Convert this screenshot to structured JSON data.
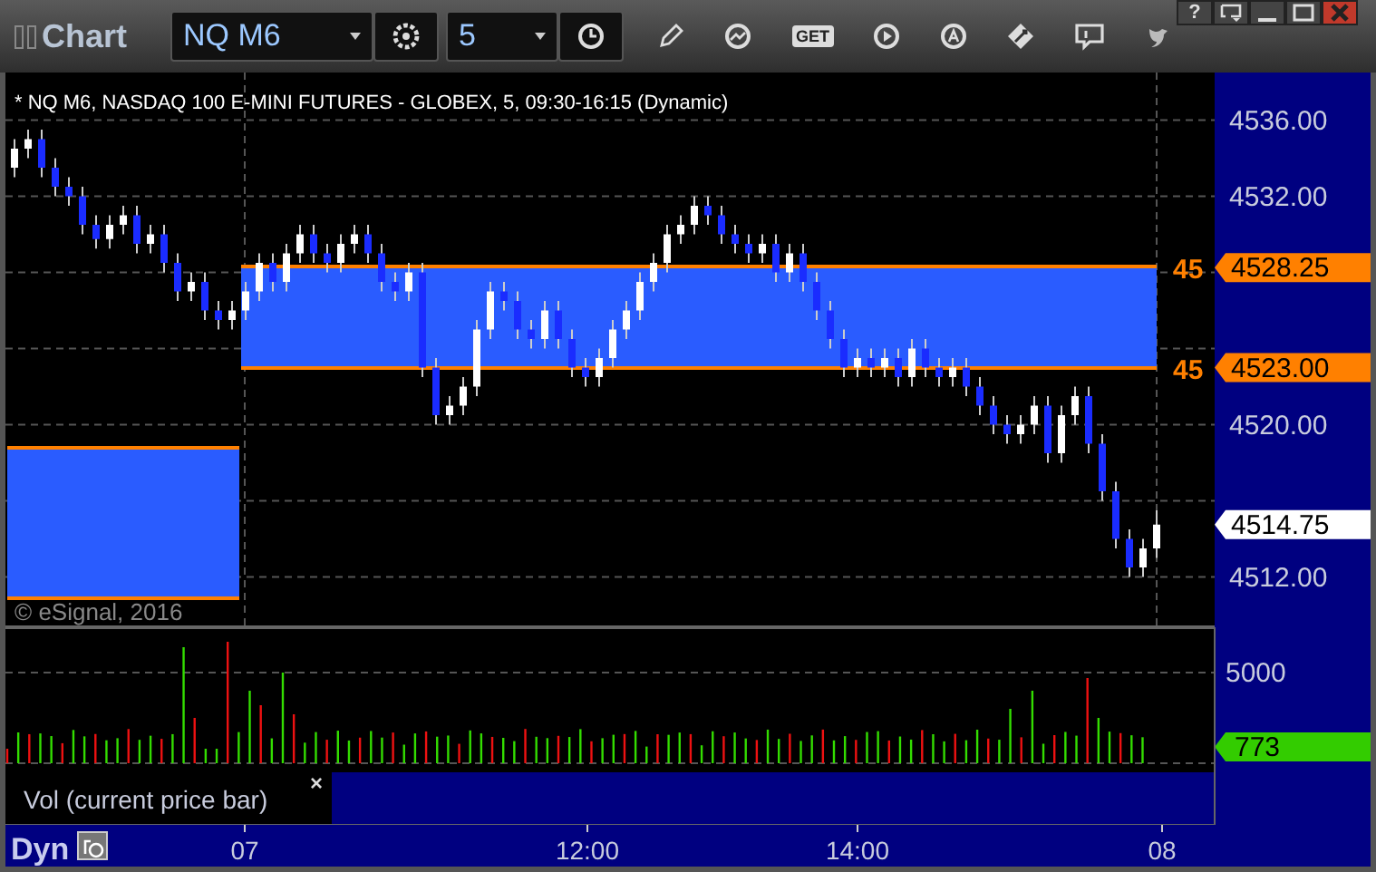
{
  "window": {
    "title": "Chart"
  },
  "toolbar": {
    "symbol": "NQ M6",
    "interval": "5",
    "get_label": "GET"
  },
  "window_buttons": [
    {
      "kind": "help",
      "label": "?"
    },
    {
      "kind": "menu"
    },
    {
      "kind": "minimize"
    },
    {
      "kind": "maximize"
    },
    {
      "kind": "close"
    }
  ],
  "chart": {
    "header": "* NQ M6, NASDAQ 100 E-MINI FUTURES - GLOBEX, 5, 09:30-16:15 (Dynamic)",
    "copyright": "© eSignal, 2016",
    "chart_data": {
      "type": "candlestick",
      "ylim": [
        4509.5,
        4538.5
      ],
      "grid": true,
      "yticks": [
        {
          "value": 4536,
          "label": "4536.00"
        },
        {
          "value": 4532,
          "label": "4532.00"
        },
        {
          "value": 4520,
          "label": "4520.00"
        },
        {
          "value": 4512,
          "label": "4512.00"
        }
      ],
      "ohlc": [
        [
          4533.5,
          4535,
          4533,
          4534.5
        ],
        [
          4534.5,
          4535.5,
          4534,
          4535
        ],
        [
          4535,
          4535.5,
          4533,
          4533.5
        ],
        [
          4533.5,
          4534,
          4532,
          4532.5
        ],
        [
          4532.5,
          4533,
          4531.5,
          4532
        ],
        [
          4532,
          4532.5,
          4530,
          4530.5
        ],
        [
          4530.5,
          4531,
          4529.25,
          4529.75
        ],
        [
          4529.75,
          4531,
          4529.25,
          4530.5
        ],
        [
          4530.5,
          4531.5,
          4530,
          4531
        ],
        [
          4531,
          4531.5,
          4529,
          4529.5
        ],
        [
          4529.5,
          4530.5,
          4529,
          4530
        ],
        [
          4530,
          4530.5,
          4528,
          4528.5
        ],
        [
          4528.5,
          4529,
          4526.5,
          4527
        ],
        [
          4527,
          4528,
          4526.5,
          4527.5
        ],
        [
          4527.5,
          4528,
          4525.5,
          4526
        ],
        [
          4526,
          4526.5,
          4525,
          4525.5
        ],
        [
          4525.5,
          4526.5,
          4525,
          4526
        ],
        [
          4526,
          4527.5,
          4525.5,
          4527
        ],
        [
          4527,
          4529,
          4526.5,
          4528.5
        ],
        [
          4528.5,
          4529,
          4527,
          4527.5
        ],
        [
          4527.5,
          4529.5,
          4527,
          4529
        ],
        [
          4529,
          4530.5,
          4528.5,
          4530
        ],
        [
          4530,
          4530.5,
          4528.5,
          4529
        ],
        [
          4529,
          4529.5,
          4528,
          4528.5
        ],
        [
          4528.5,
          4530,
          4528,
          4529.5
        ],
        [
          4529.5,
          4530.5,
          4529,
          4530
        ],
        [
          4530,
          4530.5,
          4528.5,
          4529
        ],
        [
          4529,
          4529.5,
          4527,
          4527.5
        ],
        [
          4527.5,
          4528,
          4526.5,
          4527
        ],
        [
          4527,
          4528.5,
          4526.5,
          4528
        ],
        [
          4528,
          4528.5,
          4522.5,
          4523
        ],
        [
          4523,
          4523.5,
          4520,
          4520.5
        ],
        [
          4520.5,
          4521.5,
          4520,
          4521
        ],
        [
          4521,
          4522.5,
          4520.5,
          4522
        ],
        [
          4522,
          4525.5,
          4521.5,
          4525
        ],
        [
          4525,
          4527.5,
          4524.5,
          4527
        ],
        [
          4527,
          4527.5,
          4526,
          4526.5
        ],
        [
          4526.5,
          4527,
          4524.5,
          4525
        ],
        [
          4525,
          4525.5,
          4524,
          4524.5
        ],
        [
          4524.5,
          4526.5,
          4524,
          4526
        ],
        [
          4526,
          4526.5,
          4524,
          4524.5
        ],
        [
          4524.5,
          4525,
          4522.5,
          4523
        ],
        [
          4523,
          4523.5,
          4522,
          4522.5
        ],
        [
          4522.5,
          4524,
          4522,
          4523.5
        ],
        [
          4523.5,
          4525.5,
          4523,
          4525
        ],
        [
          4525,
          4526.5,
          4524.5,
          4526
        ],
        [
          4526,
          4528,
          4525.5,
          4527.5
        ],
        [
          4527.5,
          4529,
          4527,
          4528.5
        ],
        [
          4528.5,
          4530.5,
          4528,
          4530
        ],
        [
          4530,
          4531,
          4529.5,
          4530.5
        ],
        [
          4530.5,
          4532,
          4530,
          4531.5
        ],
        [
          4531.5,
          4532,
          4530.5,
          4531
        ],
        [
          4531,
          4531.5,
          4529.5,
          4530
        ],
        [
          4530,
          4530.5,
          4529,
          4529.5
        ],
        [
          4529.5,
          4530,
          4528.5,
          4529
        ],
        [
          4529,
          4530,
          4528.5,
          4529.5
        ],
        [
          4529.5,
          4530,
          4527.5,
          4528
        ],
        [
          4528,
          4529.5,
          4527.5,
          4529
        ],
        [
          4529,
          4529.5,
          4527,
          4527.5
        ],
        [
          4527.5,
          4528,
          4525.5,
          4526
        ],
        [
          4526,
          4526.5,
          4524,
          4524.5
        ],
        [
          4524.5,
          4525,
          4522.5,
          4523
        ],
        [
          4523,
          4524,
          4522.5,
          4523.5
        ],
        [
          4523.5,
          4524,
          4522.5,
          4523
        ],
        [
          4523,
          4524,
          4522.5,
          4523.5
        ],
        [
          4523.5,
          4524,
          4522,
          4522.5
        ],
        [
          4522.5,
          4524.5,
          4522,
          4524
        ],
        [
          4524,
          4524.5,
          4522.5,
          4523
        ],
        [
          4523,
          4523.5,
          4522,
          4522.5
        ],
        [
          4522.5,
          4523.5,
          4522,
          4523
        ],
        [
          4523,
          4523.5,
          4521.5,
          4522
        ],
        [
          4522,
          4522.5,
          4520.5,
          4521
        ],
        [
          4521,
          4521.5,
          4519.5,
          4520
        ],
        [
          4520,
          4520.5,
          4519,
          4519.5
        ],
        [
          4519.5,
          4520.5,
          4519,
          4520
        ],
        [
          4520,
          4521.5,
          4519.5,
          4521
        ],
        [
          4521,
          4521.5,
          4518,
          4518.5
        ],
        [
          4518.5,
          4521,
          4518,
          4520.5
        ],
        [
          4520.5,
          4522,
          4520,
          4521.5
        ],
        [
          4521.5,
          4522,
          4518.5,
          4519
        ],
        [
          4519,
          4519.5,
          4516,
          4516.5
        ],
        [
          4516.5,
          4517,
          4513.5,
          4514
        ],
        [
          4514,
          4514.5,
          4512,
          4512.5
        ],
        [
          4512.5,
          4514,
          4512,
          4513.5
        ],
        [
          4513.5,
          4515.5,
          4513,
          4514.75
        ]
      ]
    },
    "price_tags": [
      {
        "label": "4528.25",
        "side_label": "45",
        "color": "#ff8000"
      },
      {
        "label": "4523.00",
        "side_label": "45",
        "color": "#ff8000"
      },
      {
        "label": "4514.75",
        "color": "#ffffff"
      }
    ],
    "volume_axis": [
      "5000"
    ],
    "volume_tag": {
      "label": "773",
      "color": "#33cc00"
    },
    "legend": {
      "label": "Vol (current price bar)",
      "close": "×"
    },
    "time_axis": {
      "mode": "Dyn",
      "labels": [
        "07",
        "12:00",
        "14:00",
        "08"
      ]
    }
  }
}
